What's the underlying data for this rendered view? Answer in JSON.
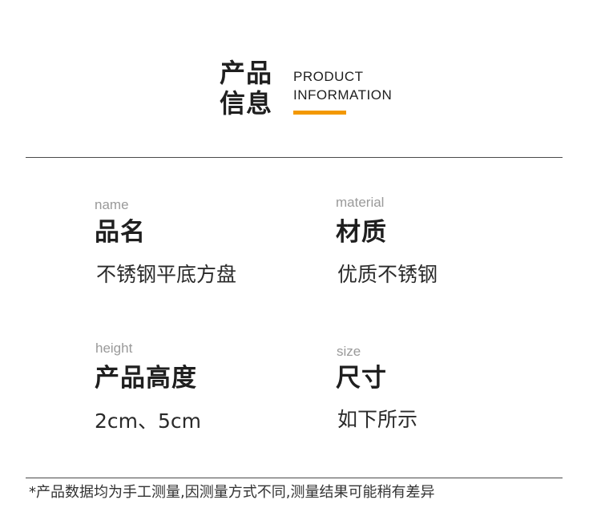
{
  "header": {
    "cn_line1": "产品",
    "cn_line2": "信息",
    "en_line1": "PRODUCT",
    "en_line2": "INFORMATION",
    "accent_color": "#f39800"
  },
  "fields": [
    {
      "en": "name",
      "cn": "品名",
      "value": "不锈钢平底方盘"
    },
    {
      "en": "material",
      "cn": "材质",
      "value": "优质不锈钢"
    },
    {
      "en": "height",
      "cn": "产品高度",
      "value": "2cm、5cm"
    },
    {
      "en": "size",
      "cn": "尺寸",
      "value": "如下所示"
    }
  ],
  "footnote": "*产品数据均为手工测量,因测量方式不同,测量结果可能稍有差异"
}
